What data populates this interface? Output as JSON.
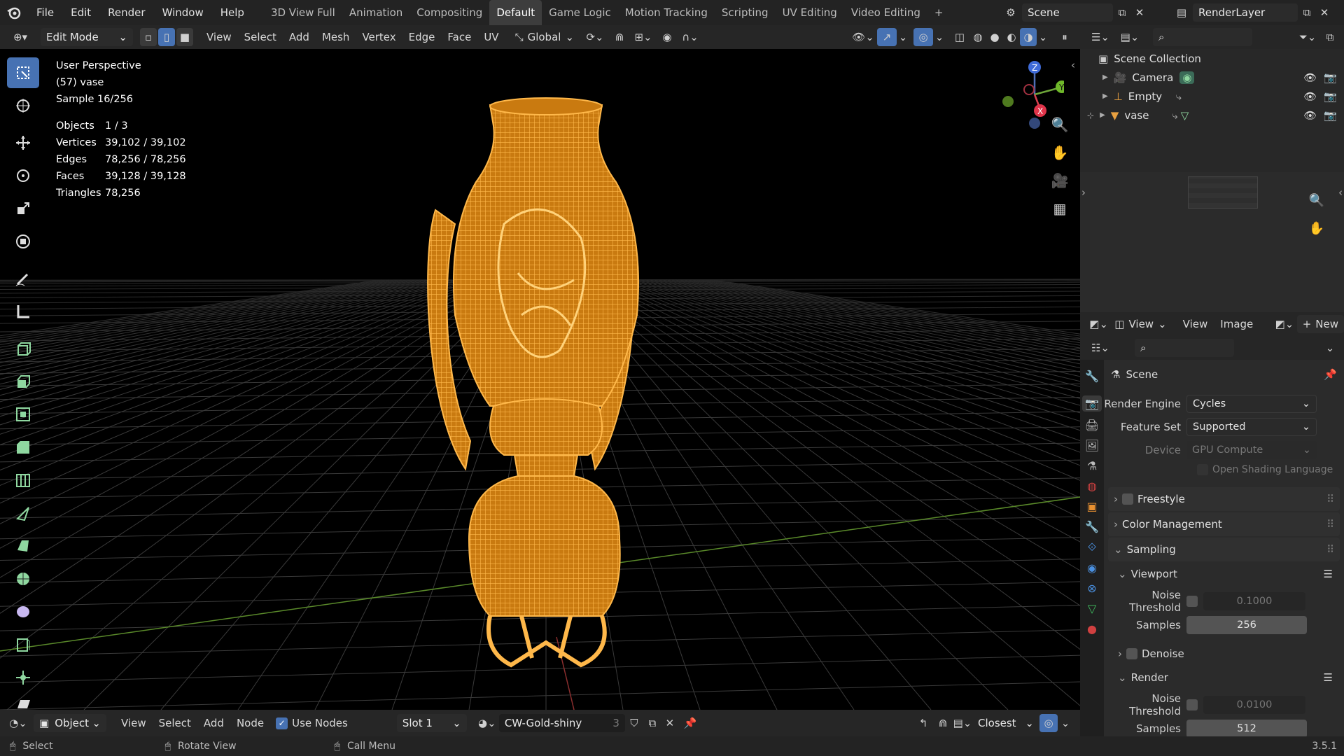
{
  "topbar": {
    "menus": [
      "File",
      "Edit",
      "Render",
      "Window",
      "Help"
    ],
    "workspaces": [
      "3D View Full",
      "Animation",
      "Compositing",
      "Default",
      "Game Logic",
      "Motion Tracking",
      "Scripting",
      "UV Editing",
      "Video Editing"
    ],
    "active_workspace": "Default",
    "scene_name": "Scene",
    "view_layer": "RenderLayer"
  },
  "viewport_header": {
    "mode": "Edit Mode",
    "menus": [
      "View",
      "Select",
      "Add",
      "Mesh",
      "Vertex",
      "Edge",
      "Face",
      "UV"
    ],
    "orientation": "Global"
  },
  "viewport": {
    "perspective": "User Perspective",
    "object_label": "(57) vase",
    "sample": "Sample 16/256",
    "stats": [
      {
        "label": "Objects",
        "value": "1 / 3"
      },
      {
        "label": "Vertices",
        "value": "39,102 / 39,102"
      },
      {
        "label": "Edges",
        "value": "78,256 / 78,256"
      },
      {
        "label": "Faces",
        "value": "39,128 / 39,128"
      },
      {
        "label": "Triangles",
        "value": "78,256"
      }
    ],
    "gizmo_axes": {
      "z": "Z",
      "y": "Y",
      "x": "X"
    }
  },
  "node_header": {
    "editor": "Object",
    "menus": [
      "View",
      "Select",
      "Add",
      "Node"
    ],
    "use_nodes_label": "Use Nodes",
    "slot": "Slot 1",
    "material": "CW-Gold-shiny",
    "users": "3",
    "snap": "Closest"
  },
  "statusbar": {
    "select": "Select",
    "rotate": "Rotate View",
    "call_menu": "Call Menu",
    "version": "3.5.1"
  },
  "outliner": {
    "root": "Scene Collection",
    "items": [
      {
        "name": "Camera"
      },
      {
        "name": "Empty"
      },
      {
        "name": "vase"
      }
    ]
  },
  "image_editor": {
    "view_label": "View",
    "menus": [
      "View",
      "Image"
    ],
    "new_label": "New"
  },
  "properties": {
    "context": "Scene",
    "render_engine_label": "Render Engine",
    "render_engine": "Cycles",
    "feature_set_label": "Feature Set",
    "feature_set": "Supported",
    "device_label": "Device",
    "device": "GPU Compute",
    "osl_label": "Open Shading Language",
    "panels": {
      "freestyle": "Freestyle",
      "color_management": "Color Management",
      "sampling": "Sampling",
      "viewport": "Viewport",
      "denoise": "Denoise",
      "render": "Render"
    },
    "viewport_noise_label": "Noise Threshold",
    "viewport_noise": "0.1000",
    "viewport_samples_label": "Samples",
    "viewport_samples": "256",
    "render_noise_label": "Noise Threshold",
    "render_noise": "0.0100",
    "render_samples_label": "Samples",
    "render_samples": "512"
  },
  "colors": {
    "accent": "#4772b3",
    "wire": "#f5a623",
    "grid_x": "#8a2e2e",
    "grid_y": "#5a8a2a"
  }
}
